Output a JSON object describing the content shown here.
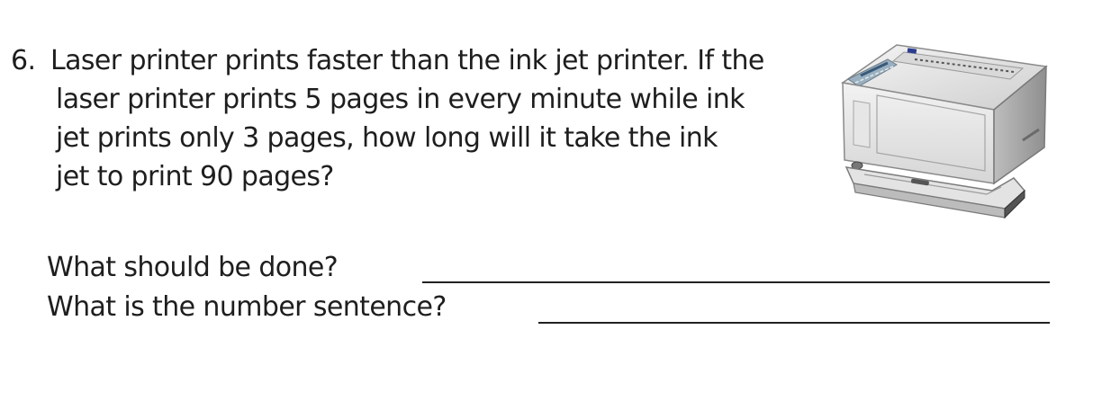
{
  "problem": {
    "number": "6.",
    "lines": [
      "Laser printer prints faster than the ink jet printer. If the",
      "laser printer prints 5 pages in every minute while ink",
      "jet prints only 3 pages, how long will it take the ink",
      "jet to print 90 pages?"
    ]
  },
  "questions": [
    "What should be done?",
    "What is the number sentence?"
  ],
  "illustration": {
    "icon": "laser-printer-icon"
  }
}
